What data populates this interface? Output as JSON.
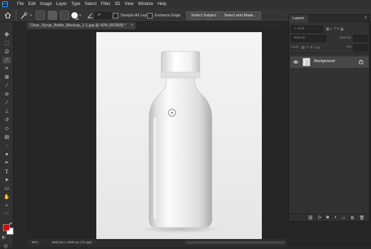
{
  "app": {
    "logo": "Ps"
  },
  "menu": [
    "File",
    "Edit",
    "Image",
    "Layer",
    "Type",
    "Select",
    "Filter",
    "3D",
    "View",
    "Window",
    "Help"
  ],
  "options": {
    "brush_size": "30",
    "angle_value": "0°",
    "sample_all_layers": "Sample All Layers",
    "enhance_edge": "Enhance Edge",
    "select_subject": "Select Subject",
    "select_and_mask": "Select and Mask..."
  },
  "document": {
    "tab_title": "Clear_Syrup_Bottle_Mockup_1-1.jpg @ 40% (RGB/8) *",
    "zoom": "40%",
    "dimensions": "1500 px x 1600 px (72 ppi)"
  },
  "colors": {
    "foreground": "#e00000",
    "background": "#ffffff",
    "accent": "#31a8ff"
  },
  "layers_panel": {
    "title": "Layers",
    "search_placeholder": "Kind",
    "blend_mode": "Normal",
    "opacity_label": "Opacity:",
    "lock_label": "Lock:",
    "fill_label": "Fill:",
    "layers": [
      {
        "name": "Background",
        "visible": true,
        "locked": true
      }
    ]
  },
  "icons": [
    "home-icon",
    "eye-icon",
    "lock-icon",
    "link-icon",
    "fx-icon",
    "mask-icon",
    "adjustment-icon",
    "folder-icon",
    "new-layer-icon",
    "trash-icon"
  ]
}
